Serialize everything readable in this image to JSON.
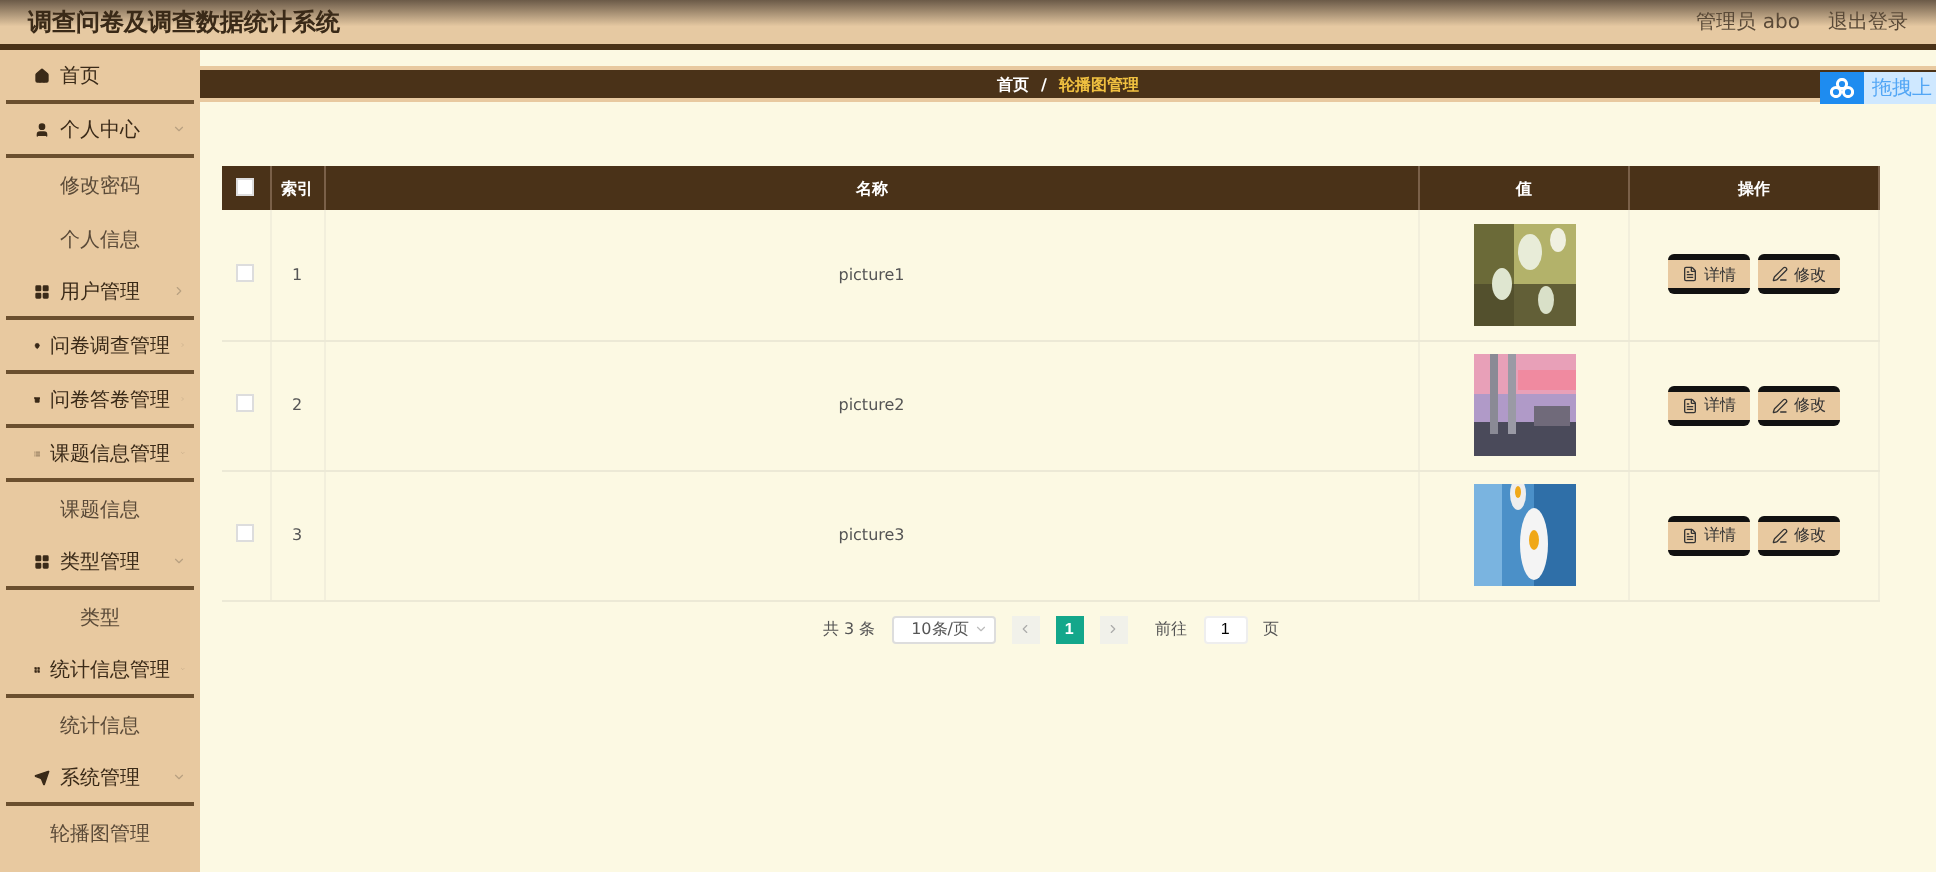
{
  "header": {
    "title": "调查问卷及调查数据统计系统",
    "user": "管理员 abo",
    "logout": "退出登录"
  },
  "sidebar": {
    "items": [
      {
        "label": "首页"
      },
      {
        "label": "个人中心",
        "expanded": true,
        "children": [
          {
            "label": "修改密码"
          },
          {
            "label": "个人信息"
          }
        ]
      },
      {
        "label": "用户管理",
        "expanded": false
      },
      {
        "label": "问卷调查管理",
        "expanded": false
      },
      {
        "label": "问卷答卷管理",
        "expanded": false
      },
      {
        "label": "课题信息管理",
        "expanded": true,
        "children": [
          {
            "label": "课题信息"
          }
        ]
      },
      {
        "label": "类型管理",
        "expanded": true,
        "children": [
          {
            "label": "类型"
          }
        ]
      },
      {
        "label": "统计信息管理",
        "expanded": true,
        "children": [
          {
            "label": "统计信息"
          }
        ]
      },
      {
        "label": "系统管理",
        "expanded": true,
        "children": [
          {
            "label": "轮播图管理"
          }
        ]
      }
    ]
  },
  "breadcrumb": {
    "items": [
      "首页",
      "轮播图管理"
    ],
    "separator": "/"
  },
  "upload_widget": {
    "label": "拖拽上"
  },
  "table": {
    "columns": [
      "索引",
      "名称",
      "值",
      "操作"
    ],
    "select_all": false,
    "rows": [
      {
        "index": "1",
        "name": "picture1",
        "checked": false,
        "image": {
          "kind": "picture"
        },
        "actions": [
          "详情",
          "修改"
        ]
      },
      {
        "index": "2",
        "name": "picture2",
        "checked": false,
        "image": {
          "kind": "picture"
        },
        "actions": [
          "详情",
          "修改"
        ]
      },
      {
        "index": "3",
        "name": "picture3",
        "checked": false,
        "image": {
          "kind": "picture"
        },
        "actions": [
          "详情",
          "修改"
        ]
      }
    ]
  },
  "pagination": {
    "total": "共 3 条",
    "page_size": "10条/页",
    "pages": [
      {
        "label": "1",
        "selected": true
      }
    ],
    "goto_label": "前往",
    "goto_value": "1",
    "goto_suffix": "页"
  }
}
